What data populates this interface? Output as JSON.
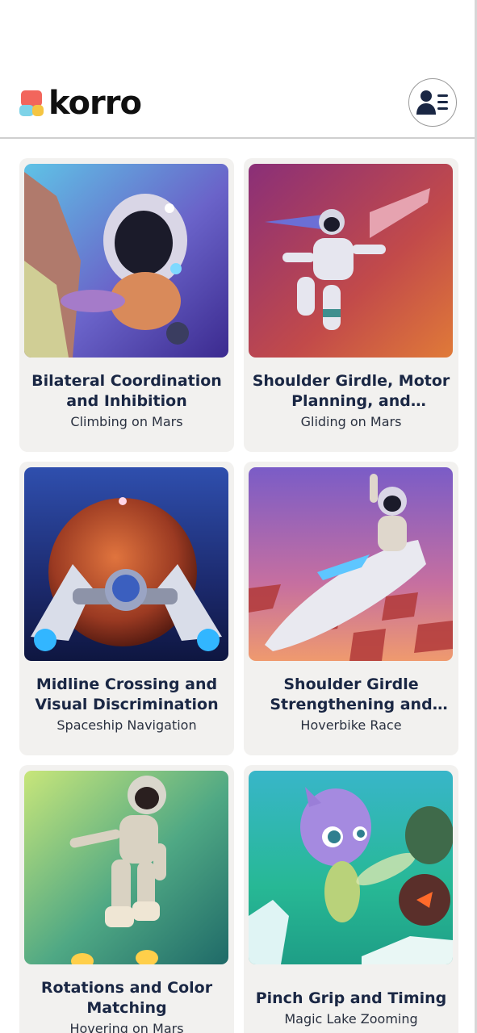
{
  "app": {
    "brand_name": "korro",
    "brand_colors": [
      "#f2665c",
      "#7ed3e8",
      "#f5c542"
    ]
  },
  "header": {
    "profile_icon": "user-menu-icon"
  },
  "cards": [
    {
      "title": "Bilateral Coordination and Inhibition",
      "subtitle": "Climbing on Mars",
      "thumbnail": "astronaut-climbing-image"
    },
    {
      "title": "Shoulder Girdle, Motor Planning, and Sequencing",
      "subtitle": "Gliding on Mars",
      "thumbnail": "astronaut-glider-image"
    },
    {
      "title": "Midline Crossing and Visual Discrimination",
      "subtitle": "Spaceship Navigation",
      "thumbnail": "spaceship-mars-image"
    },
    {
      "title": "Shoulder Girdle Strengthening and Bilateral",
      "subtitle": "Hoverbike Race",
      "thumbnail": "hoverbike-image"
    },
    {
      "title": "Rotations and Color Matching",
      "subtitle": "Hovering on Mars",
      "thumbnail": "astronaut-hover-image"
    },
    {
      "title": "Pinch Grip and Timing",
      "subtitle": "Magic Lake Zooming",
      "thumbnail": "alien-sprite-image"
    }
  ]
}
